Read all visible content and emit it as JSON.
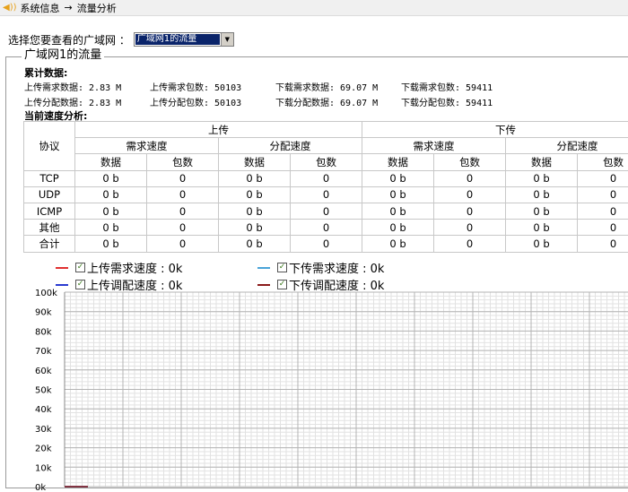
{
  "breadcrumb": {
    "section": "系统信息",
    "separator": "→",
    "page": "流量分析"
  },
  "wan_selector": {
    "label": "选择您要查看的广域网 ：",
    "selected": "广域网1的流量"
  },
  "group_title": "广域网1的流量",
  "cumulative": {
    "title": "累计数据:",
    "rows": [
      [
        "上传需求数据: 2.83 M",
        "上传需求包数: 50103",
        "下载需求数据: 69.07 M",
        "下载需求包数: 59411"
      ],
      [
        "上传分配数据: 2.83 M",
        "上传分配包数: 50103",
        "下载分配数据: 69.07 M",
        "下载分配包数: 59411"
      ]
    ]
  },
  "current": {
    "title": "当前速度分析:",
    "col_protocol": "协议",
    "upload": "上传",
    "download": "下传",
    "demand_speed": "需求速度",
    "alloc_speed": "分配速度",
    "data": "数据",
    "packets": "包数",
    "rows": [
      {
        "protocol": "TCP",
        "values": [
          "0 b",
          "0",
          "0 b",
          "0",
          "0 b",
          "0",
          "0 b",
          "0"
        ]
      },
      {
        "protocol": "UDP",
        "values": [
          "0 b",
          "0",
          "0 b",
          "0",
          "0 b",
          "0",
          "0 b",
          "0"
        ]
      },
      {
        "protocol": "ICMP",
        "values": [
          "0 b",
          "0",
          "0 b",
          "0",
          "0 b",
          "0",
          "0 b",
          "0"
        ]
      },
      {
        "protocol": "其他",
        "values": [
          "0 b",
          "0",
          "0 b",
          "0",
          "0 b",
          "0",
          "0 b",
          "0"
        ]
      },
      {
        "protocol": "合计",
        "values": [
          "0 b",
          "0",
          "0 b",
          "0",
          "0 b",
          "0",
          "0 b",
          "0"
        ]
      }
    ]
  },
  "legend": [
    {
      "label": "上传需求速度 : 0k",
      "color": "#e03030"
    },
    {
      "label": "下传需求速度 : 0k",
      "color": "#4aa3d8"
    },
    {
      "label": "上传调配速度 : 0k",
      "color": "#2a3ad0"
    },
    {
      "label": "下传调配速度 : 0k",
      "color": "#8a1a1a"
    }
  ],
  "chart_data": {
    "type": "line",
    "y_ticks": [
      "100k",
      "90k",
      "80k",
      "70k",
      "60k",
      "50k",
      "40k",
      "30k",
      "20k",
      "10k",
      "0k"
    ],
    "ylim": [
      0,
      100
    ],
    "grid": true,
    "series": [
      {
        "name": "上传需求速度",
        "values": [
          0,
          0,
          0,
          0,
          0
        ],
        "color": "#e03030"
      },
      {
        "name": "上传调配速度",
        "values": [
          0,
          0,
          0,
          0,
          0
        ],
        "color": "#2a3ad0"
      },
      {
        "name": "下传需求速度",
        "values": [
          0,
          0,
          0,
          0,
          0
        ],
        "color": "#4aa3d8"
      },
      {
        "name": "下传调配速度",
        "values": [
          0,
          0,
          0,
          0,
          0
        ],
        "color": "#8a1a1a"
      }
    ]
  }
}
